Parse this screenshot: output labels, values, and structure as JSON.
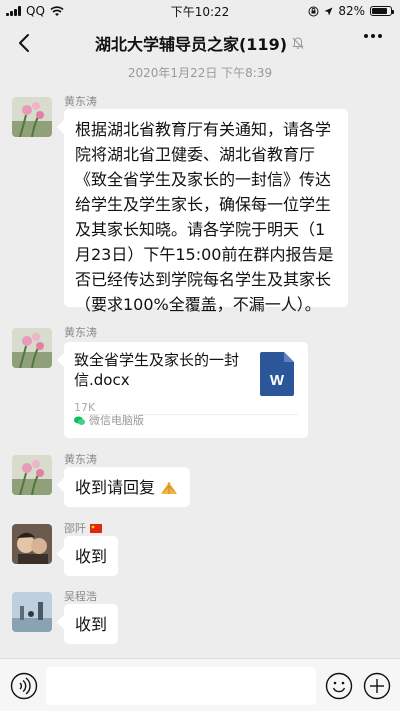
{
  "status_bar": {
    "carrier": "QQ",
    "time": "下午10:22",
    "battery": "82%",
    "battery_level": 0.82
  },
  "nav": {
    "title": "湖北大学辅导员之家(119)"
  },
  "timestamp": "2020年1月22日 下午8:39",
  "messages": [
    {
      "sender": "黄东涛",
      "text": "根据湖北省教育厅有关通知，请各学院将湖北省卫健委、湖北省教育厅《致全省学生及家长的一封信》传达给学生及学生家长，确保每一位学生及其家长知晓。请各学院于明天（1月23日）下午15:00前在群内报告是否已经传达到学院每名学生及其家长（要求100%全覆盖，不漏一人）。"
    },
    {
      "sender": "黄东涛",
      "file_name": "致全省学生及家长的一封信.docx",
      "file_size": "17K",
      "file_type_label": "W",
      "source": "微信电脑版"
    },
    {
      "sender": "黄东涛",
      "text": "收到请回复"
    },
    {
      "sender": "邵阡",
      "text": "收到"
    },
    {
      "sender": "吴程浩",
      "text": "收到"
    }
  ],
  "input": {
    "placeholder": ""
  },
  "colors": {
    "background": "#ededed",
    "bubble": "#ffffff",
    "word_blue": "#2b579a",
    "accent_green": "#07c160"
  }
}
